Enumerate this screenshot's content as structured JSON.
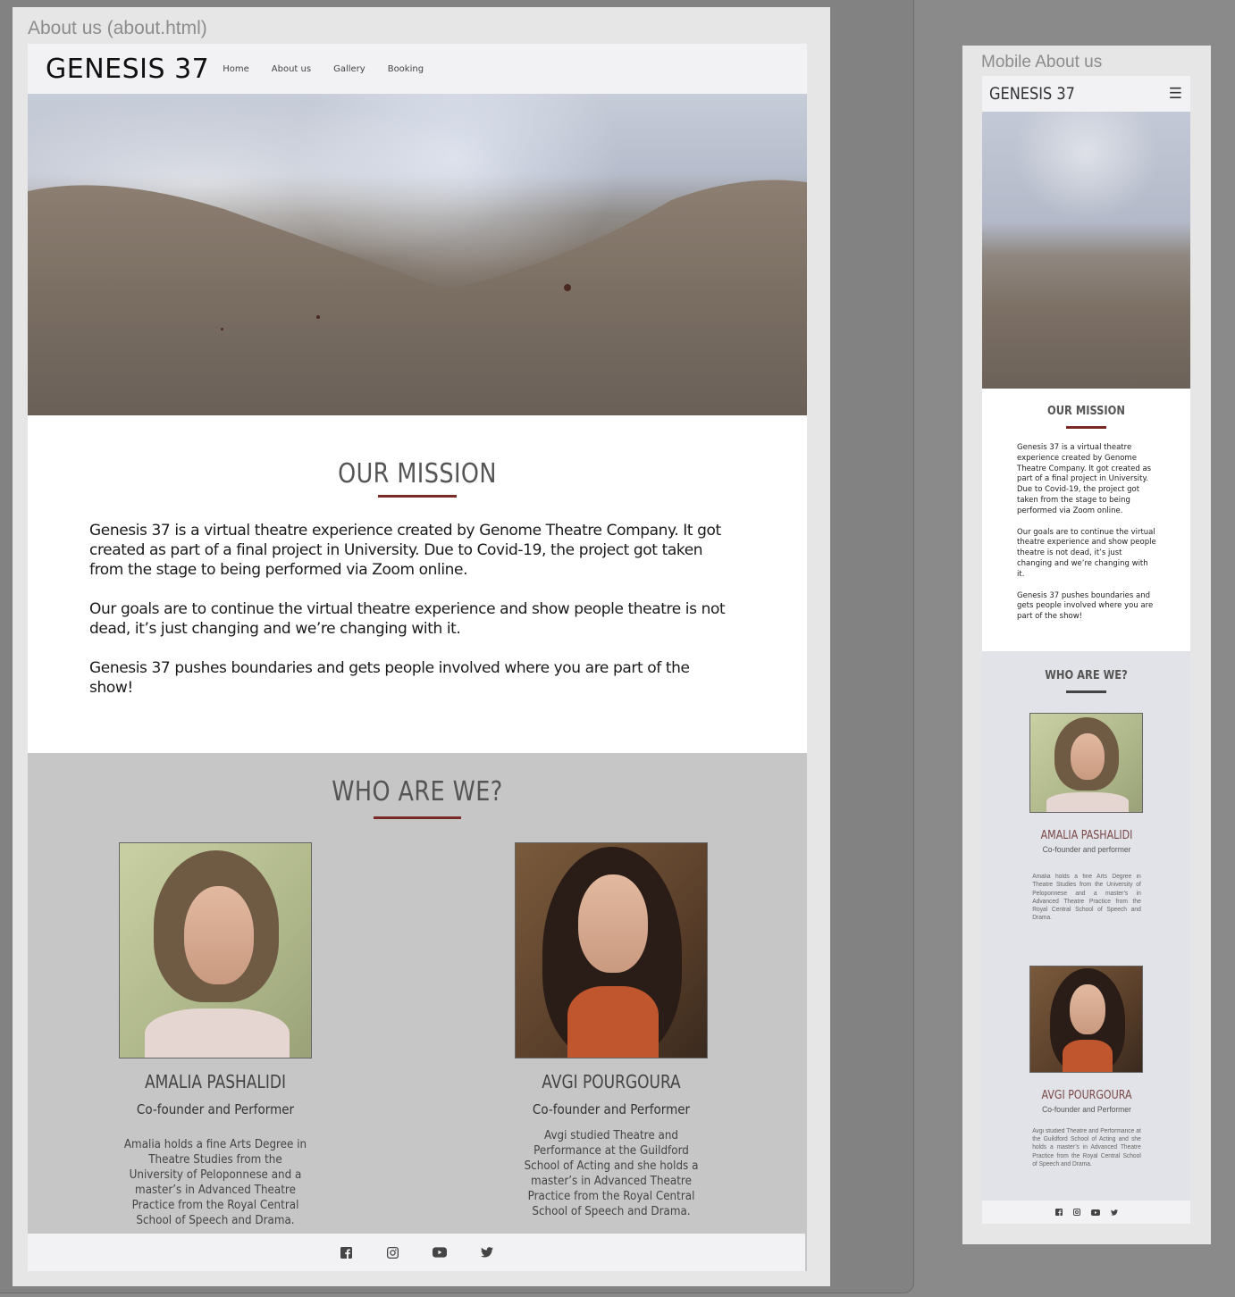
{
  "desktop": {
    "frame_label": "About us (about.html)",
    "logo": "GENESIS 37",
    "nav": [
      "Home",
      "About us",
      "Gallery",
      "Booking"
    ],
    "mission": {
      "title": "OUR MISSION",
      "paragraphs": [
        "Genesis 37 is a virtual theatre experience created by Genome Theatre Company. It got created as part of a final project in University. Due to Covid-19, the project got taken from the stage to being performed via Zoom online.",
        "Our goals are to continue the virtual theatre experience and show people theatre is not dead, it’s just changing and we’re changing with it.",
        "Genesis 37 pushes boundaries and gets people involved where you are part of the show!"
      ]
    },
    "who": {
      "title": "WHO ARE WE?",
      "members": [
        {
          "name": "AMALIA PASHALIDI",
          "role": "Co-founder and Performer",
          "bio": "Amalia holds a fine Arts Degree in Theatre Studies from the University of Peloponnese and a master’s in Advanced Theatre Practice from the Royal Central School of Speech and Drama."
        },
        {
          "name": "AVGI POURGOURA",
          "role": "Co-founder and Performer",
          "bio": "Avgi studied Theatre and Performance at the Guildford School of Acting and she holds a master’s in Advanced Theatre Practice from the Royal Central School of Speech and Drama."
        }
      ]
    },
    "footer_icons": [
      "facebook-icon",
      "instagram-icon",
      "youtube-icon",
      "twitter-icon"
    ]
  },
  "mobile": {
    "frame_label": "Mobile About us",
    "logo": "GENESIS 37",
    "menu_icon": "hamburger-icon",
    "mission": {
      "title": "OUR MISSION",
      "paragraphs": [
        "Genesis 37 is a virtual theatre experience created by Genome Theatre Company. It got created as part of a final project in University. Due to Covid-19, the project got taken from the stage to being performed via Zoom online.",
        "Our goals are to continue the virtual theatre experience and show people theatre is not dead, it’s just changing and we’re changing with it.",
        "Genesis 37 pushes boundaries and gets people involved where you are part of the show!"
      ]
    },
    "who": {
      "title": "WHO ARE WE?",
      "members": [
        {
          "name": "AMALIA PASHALIDI",
          "role": "Co-founder and performer",
          "bio": "Amalia holds a fine Arts Degree in Theatre Studies from the University of Peloponnese and a master’s in Advanced Theatre Practice from the Royal Central School of Speech and Drama."
        },
        {
          "name": "AVGI POURGOURA",
          "role": "Co-founder and Performer",
          "bio": "Avgi studied Theatre and Performance at the Guildford School of Acting and she holds a master’s in Advanced Theatre Practice from the Royal Central School of Speech and Drama."
        }
      ]
    }
  },
  "colors": {
    "accent_rule": "#7a2a26",
    "desktop_who_bg": "#c6c6c6",
    "mobile_who_bg": "#e2e3e8",
    "mobile_member_name": "#7a4848"
  }
}
